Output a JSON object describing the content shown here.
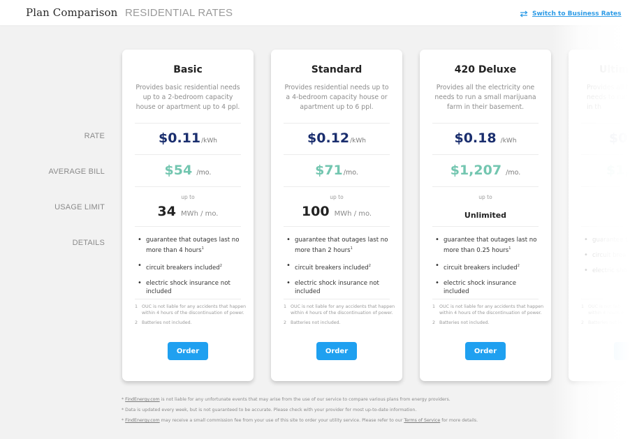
{
  "header": {
    "title": "Plan Comparison",
    "subtitle": "RESIDENTIAL RATES",
    "switch_link": "Switch to Business Rates",
    "switch_icon": "swap-arrows-icon",
    "accent_color": "#2d9be6"
  },
  "row_labels": {
    "rate": "RATE",
    "average_bill": "AVERAGE BILL",
    "usage_limit": "USAGE LIMIT",
    "details": "DETAILS"
  },
  "plans": [
    {
      "name": "Basic",
      "description": "Provides basic residential needs up to a 2-bedroom capacity house or apartment up to 4 ppl.",
      "rate": "$0.11",
      "rate_unit": "/kWh",
      "bill": "$54",
      "bill_unit": "/mo.",
      "limit_prefix": "up to",
      "limit_value": "34",
      "limit_unit": "MWh / mo.",
      "details": [
        {
          "text": "guarantee that outages last no more than 4 hours",
          "sup": "1"
        },
        {
          "text": "circuit breakers included",
          "sup": "2"
        },
        {
          "text": "electric shock insurance not included",
          "sup": ""
        }
      ],
      "footnotes": [
        {
          "num": "1",
          "text": "OUC is not liable for any accidents that happen within 4 hours of the discontinuation of power."
        },
        {
          "num": "2",
          "text": "Batteries not included."
        }
      ],
      "order_label": "Order"
    },
    {
      "name": "Standard",
      "description": "Provides residential needs up to a 4-bedroom capacity house or apartment up to 6 ppl.",
      "rate": "$0.12",
      "rate_unit": "/kWh",
      "bill": "$71",
      "bill_unit": "/mo.",
      "limit_prefix": "up to",
      "limit_value": "100",
      "limit_unit": "MWh / mo.",
      "details": [
        {
          "text": "guarantee that outages last no more than 2 hours",
          "sup": "1"
        },
        {
          "text": "circuit breakers included",
          "sup": "2"
        },
        {
          "text": "electric shock insurance not included",
          "sup": ""
        }
      ],
      "footnotes": [
        {
          "num": "1",
          "text": "OUC is not liable for any accidents that happen within 4 hours of the discontinuation of power."
        },
        {
          "num": "2",
          "text": "Batteries not included."
        }
      ],
      "order_label": "Order"
    },
    {
      "name": "420 Deluxe",
      "description": "Provides all the electricity one needs to run a small marijuana farm in their basement.",
      "rate": "$0.18",
      "rate_unit": "/kWh",
      "bill": "$1,207",
      "bill_unit": "/mo.",
      "limit_prefix": "up to",
      "limit_value": "Unlimited",
      "limit_unit": "",
      "details": [
        {
          "text": "guarantee that outages last no more than 0.25 hours",
          "sup": "1"
        },
        {
          "text": "circuit breakers included",
          "sup": "2"
        },
        {
          "text": "electric shock insurance included",
          "sup": ""
        }
      ],
      "footnotes": [
        {
          "num": "1",
          "text": "OUC is not liable for any accidents that happen within 4 hours of the discontinuation of power."
        },
        {
          "num": "2",
          "text": "Batteries not included."
        }
      ],
      "order_label": "Order"
    },
    {
      "name": "Ultim",
      "description": "Provides all t needs to run farm in th",
      "rate": "$0.",
      "rate_unit": "",
      "bill": "$1,2",
      "bill_unit": "",
      "limit_prefix": "",
      "limit_value": "",
      "limit_unit": "",
      "details": [
        {
          "text": "guarantee t more than 0",
          "sup": ""
        },
        {
          "text": "circuit brea",
          "sup": ""
        },
        {
          "text": "electric sho",
          "sup": ""
        }
      ],
      "footnotes": [
        {
          "num": "1",
          "text": "OUC is not liab within 4 hours o"
        },
        {
          "num": "2",
          "text": "Batteries not in"
        }
      ],
      "order_label": ""
    }
  ],
  "disclaimers": [
    {
      "prefix": "* ",
      "link": "FindEnergy.com",
      "text": " is not liable for any unfortunate events that may arise from the use of our service to compare various plans from energy providers.",
      "link2": "",
      "suffix": ""
    },
    {
      "prefix": "* Data is updated every week, but is not guaranteed to be accurate. Please check with your provider for most up-to-date information.",
      "link": "",
      "text": "",
      "link2": "",
      "suffix": ""
    },
    {
      "prefix": "* ",
      "link": "FindEnergy.com",
      "text": " may receive a small commission fee from your use of this site to order your utility service. Please refer to our ",
      "link2": "Terms of Service",
      "suffix": " for more details."
    }
  ],
  "colors": {
    "rate": "#1a2e6e",
    "bill": "#73c6b0",
    "button": "#1fa0f0"
  }
}
